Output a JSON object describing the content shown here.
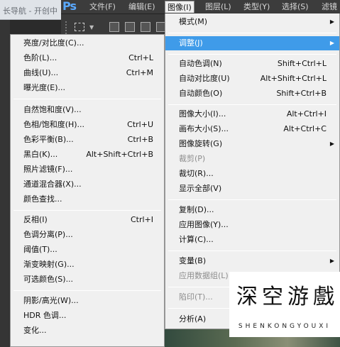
{
  "browser_tab": {
    "text": "长导航 - 开创中"
  },
  "menubar": {
    "logo": "Ps",
    "items": [
      {
        "label": "文件(F)"
      },
      {
        "label": "编辑(E)"
      },
      {
        "label": "图像(I)"
      },
      {
        "label": "图层(L)"
      },
      {
        "label": "类型(Y)"
      },
      {
        "label": "选择(S)"
      },
      {
        "label": "滤镜"
      }
    ]
  },
  "adjust_submenu": {
    "items": [
      {
        "label": "亮度/对比度(C)...",
        "shortcut": ""
      },
      {
        "label": "色阶(L)...",
        "shortcut": "Ctrl+L"
      },
      {
        "label": "曲线(U)...",
        "shortcut": "Ctrl+M"
      },
      {
        "label": "曝光度(E)...",
        "shortcut": ""
      },
      {
        "label": "自然饱和度(V)...",
        "shortcut": ""
      },
      {
        "label": "色相/饱和度(H)...",
        "shortcut": "Ctrl+U"
      },
      {
        "label": "色彩平衡(B)...",
        "shortcut": "Ctrl+B"
      },
      {
        "label": "黑白(K)...",
        "shortcut": "Alt+Shift+Ctrl+B"
      },
      {
        "label": "照片滤镜(F)...",
        "shortcut": ""
      },
      {
        "label": "通道混合器(X)...",
        "shortcut": ""
      },
      {
        "label": "颜色查找...",
        "shortcut": ""
      },
      {
        "label": "反相(I)",
        "shortcut": "Ctrl+I"
      },
      {
        "label": "色调分离(P)...",
        "shortcut": ""
      },
      {
        "label": "阈值(T)...",
        "shortcut": ""
      },
      {
        "label": "渐变映射(G)...",
        "shortcut": ""
      },
      {
        "label": "可选颜色(S)...",
        "shortcut": ""
      },
      {
        "label": "阴影/高光(W)...",
        "shortcut": ""
      },
      {
        "label": "HDR 色调...",
        "shortcut": ""
      },
      {
        "label": "变化...",
        "shortcut": ""
      }
    ]
  },
  "image_menu": {
    "items": [
      {
        "label": "模式(M)",
        "shortcut": "",
        "submenu": true,
        "disabled": false
      },
      {
        "label": "调整(J)",
        "shortcut": "",
        "submenu": true,
        "disabled": false,
        "highlighted": true
      },
      {
        "label": "自动色调(N)",
        "shortcut": "Shift+Ctrl+L",
        "disabled": false
      },
      {
        "label": "自动对比度(U)",
        "shortcut": "Alt+Shift+Ctrl+L",
        "disabled": false
      },
      {
        "label": "自动颜色(O)",
        "shortcut": "Shift+Ctrl+B",
        "disabled": false
      },
      {
        "label": "图像大小(I)...",
        "shortcut": "Alt+Ctrl+I",
        "disabled": false
      },
      {
        "label": "画布大小(S)...",
        "shortcut": "Alt+Ctrl+C",
        "disabled": false
      },
      {
        "label": "图像旋转(G)",
        "shortcut": "",
        "submenu": true,
        "disabled": false
      },
      {
        "label": "裁剪(P)",
        "shortcut": "",
        "disabled": true
      },
      {
        "label": "裁切(R)...",
        "shortcut": "",
        "disabled": false
      },
      {
        "label": "显示全部(V)",
        "shortcut": "",
        "disabled": false
      },
      {
        "label": "复制(D)...",
        "shortcut": "",
        "disabled": false
      },
      {
        "label": "应用图像(Y)...",
        "shortcut": "",
        "disabled": false
      },
      {
        "label": "计算(C)...",
        "shortcut": "",
        "disabled": false
      },
      {
        "label": "变量(B)",
        "shortcut": "",
        "submenu": true,
        "disabled": false
      },
      {
        "label": "应用数据组(L)",
        "shortcut": "",
        "disabled": true
      },
      {
        "label": "陷印(T)...",
        "shortcut": "",
        "disabled": true
      },
      {
        "label": "分析(A)",
        "shortcut": "",
        "submenu": false,
        "disabled": false
      }
    ]
  },
  "watermark": {
    "chars": [
      "深",
      "空",
      "游",
      "戲"
    ],
    "subtitle": "SHENKONGYOUXI"
  },
  "colors": {
    "highlight": "#3f9be9",
    "menu_bg": "#f0f0f0",
    "menubar_bg": "#3c3c3c",
    "ps_logo": "#5aa9ff"
  }
}
